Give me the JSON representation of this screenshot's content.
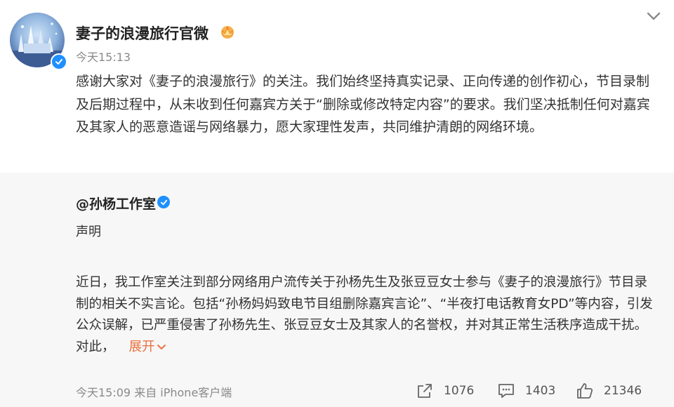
{
  "post": {
    "author": "妻子的浪漫旅行官微",
    "time": "今天15:13",
    "text": "感谢大家对《妻子的浪漫旅行》的关注。我们始终坚持真实记录、正向传递的创作初心，节目录制及后期过程中，从未收到任何嘉宾方关于“删除或修改特定内容”的要求。我们坚决抵制任何对嘉宾及其家人的恶意造谣与网络暴力，愿大家理性发声，共同维护清朗的网络环境。"
  },
  "repost": {
    "author": "@孙杨工作室",
    "heading": "声明",
    "text": "近日，我工作室关注到部分网络用户流传关于孙杨先生及张豆豆女士参与《妻子的浪漫旅行》节目录制的相关不实言论。包括“孙杨妈妈致电节目组删除嘉宾言论”、“半夜打电话教育女PD”等内容，引发公众误解，已严重侵害了孙杨先生、张豆豆女士及其家人的名誉权，并对其正常生活秩序造成干扰。对此，",
    "expand_label": "展开",
    "footer_time": "今天15:09 来自 iPhone客户端",
    "shares": "1076",
    "comments": "1403",
    "likes": "21346"
  },
  "colors": {
    "accent": "#eb7340",
    "verified": "#1e90ff",
    "repost_bg": "#f7f7f7"
  },
  "icons": [
    "avatar",
    "verified-icon",
    "vip-crown-icon",
    "chevron-down-icon",
    "share-icon",
    "comment-icon",
    "like-icon"
  ]
}
